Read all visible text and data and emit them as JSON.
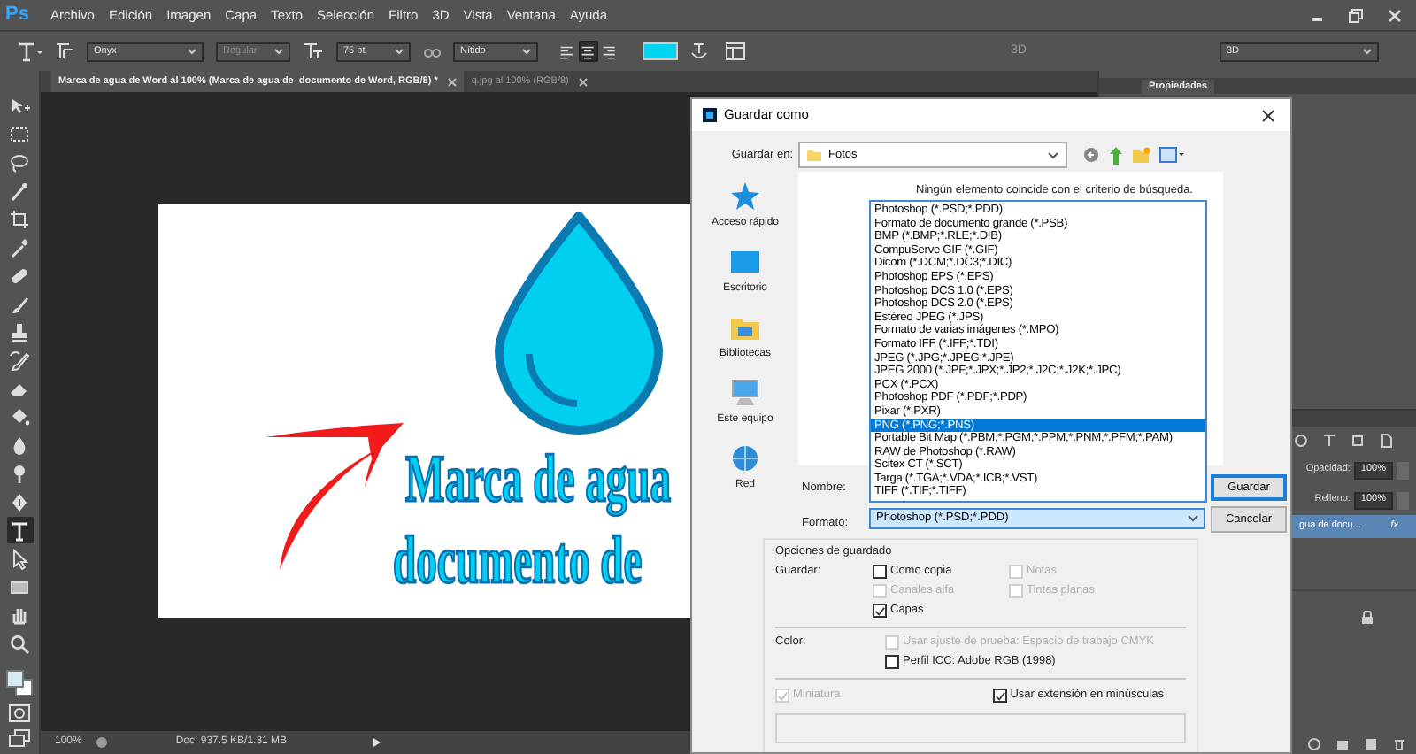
{
  "app": {
    "logo": "Ps",
    "menu": [
      "Archivo",
      "Edición",
      "Imagen",
      "Capa",
      "Texto",
      "Selección",
      "Filtro",
      "3D",
      "Vista",
      "Ventana",
      "Ayuda"
    ]
  },
  "options_bar": {
    "font": "Onyx",
    "style": "Regular",
    "style_disabled": true,
    "size": "75 pt",
    "antialias": "Nítido",
    "alignment": [
      {
        "selected": false
      },
      {
        "selected": true
      },
      {
        "selected": false
      }
    ],
    "swatch": {
      "color": "#00d4f0"
    },
    "mode_label": "3D",
    "workspace": "3D"
  },
  "tabs": [
    {
      "label": "Marca de agua de Word al 100% (Marca de agua de  documento de Word, RGB/8) *",
      "selected": true
    },
    {
      "label": "q.jpg al 100% (RGB/8)",
      "selected": false
    }
  ],
  "tools": [
    {
      "kind": "move",
      "selected": false
    },
    {
      "kind": "marquee",
      "selected": false
    },
    {
      "kind": "lasso",
      "selected": false
    },
    {
      "kind": "wand",
      "selected": false
    },
    {
      "kind": "crop",
      "selected": false
    },
    {
      "kind": "eyedropper",
      "selected": false
    },
    {
      "kind": "bandage",
      "selected": false
    },
    {
      "kind": "brush",
      "selected": false
    },
    {
      "kind": "stamp",
      "selected": false
    },
    {
      "kind": "history",
      "selected": false
    },
    {
      "kind": "eraser",
      "selected": false
    },
    {
      "kind": "bucket",
      "selected": false
    },
    {
      "kind": "drop",
      "selected": false
    },
    {
      "kind": "dodge",
      "selected": false
    },
    {
      "kind": "pen",
      "selected": false
    },
    {
      "kind": "type",
      "selected": true
    },
    {
      "kind": "select",
      "selected": false
    },
    {
      "kind": "rectangle",
      "selected": false
    },
    {
      "kind": "hand",
      "selected": false
    },
    {
      "kind": "zoom",
      "selected": false
    }
  ],
  "document": {
    "lines": [
      "Marca de agua",
      "documento de"
    ]
  },
  "status_bar": {
    "zoom": "100%",
    "doc": "Doc: 937.5 KB/1.31 MB"
  },
  "properties_panel": {
    "tab": "Propiedades"
  },
  "layers_panel": {
    "opacity_label": "Opacidad:",
    "opacity": "100%",
    "fill_label": "Relleno:",
    "fill": "100%",
    "layers": [
      {
        "name": "gua de docu...",
        "selected": true,
        "effects": "fx"
      }
    ]
  },
  "dialog": {
    "title": "Guardar como",
    "save_in_label": "Guardar en:",
    "folder": "Fotos",
    "places": [
      {
        "kind": "star",
        "label": "Acceso rápido"
      },
      {
        "kind": "desktop",
        "label": "Escritorio"
      },
      {
        "kind": "library",
        "label": "Bibliotecas"
      },
      {
        "kind": "computer",
        "label": "Este equipo"
      },
      {
        "kind": "network",
        "label": "Red"
      }
    ],
    "empty_message": "Ningún elemento coincide con el criterio de búsqueda.",
    "name_label": "Nombre:",
    "format_label": "Formato:",
    "format_value": "Photoshop (*.PSD;*.PDD)",
    "format_options": [
      {
        "label": "Photoshop (*.PSD;*.PDD)",
        "selected": false
      },
      {
        "label": "Formato de documento grande (*.PSB)",
        "selected": false
      },
      {
        "label": "BMP (*.BMP;*.RLE;*.DIB)",
        "selected": false
      },
      {
        "label": "CompuServe GIF (*.GIF)",
        "selected": false
      },
      {
        "label": "Dicom (*.DCM;*.DC3;*.DIC)",
        "selected": false
      },
      {
        "label": "Photoshop EPS (*.EPS)",
        "selected": false
      },
      {
        "label": "Photoshop DCS 1.0 (*.EPS)",
        "selected": false
      },
      {
        "label": "Photoshop DCS 2.0 (*.EPS)",
        "selected": false
      },
      {
        "label": "Estéreo JPEG (*.JPS)",
        "selected": false
      },
      {
        "label": "Formato de varias imágenes (*.MPO)",
        "selected": false
      },
      {
        "label": "Formato IFF (*.IFF;*.TDI)",
        "selected": false
      },
      {
        "label": "JPEG (*.JPG;*.JPEG;*.JPE)",
        "selected": false
      },
      {
        "label": "JPEG 2000 (*.JPF;*.JPX;*.JP2;*.J2C;*.J2K;*.JPC)",
        "selected": false
      },
      {
        "label": "PCX (*.PCX)",
        "selected": false
      },
      {
        "label": "Photoshop PDF (*.PDF;*.PDP)",
        "selected": false
      },
      {
        "label": "Pixar (*.PXR)",
        "selected": false
      },
      {
        "label": "PNG (*.PNG;*.PNS)",
        "selected": true
      },
      {
        "label": "Portable Bit Map (*.PBM;*.PGM;*.PPM;*.PNM;*.PFM;*.PAM)",
        "selected": false
      },
      {
        "label": "RAW de Photoshop (*.RAW)",
        "selected": false
      },
      {
        "label": "Scitex CT (*.SCT)",
        "selected": false
      },
      {
        "label": "Targa (*.TGA;*.VDA;*.ICB;*.VST)",
        "selected": false
      },
      {
        "label": "TIFF (*.TIF;*.TIFF)",
        "selected": false
      }
    ],
    "buttons": [
      {
        "label": "Guardar",
        "default": true
      },
      {
        "label": "Cancelar",
        "default": false
      }
    ],
    "options": {
      "title": "Opciones de guardado",
      "save_label": "Guardar:",
      "save_checks": [
        {
          "label": "Como copia",
          "checked": false,
          "disabled": false
        },
        {
          "label": "Notas",
          "checked": false,
          "disabled": true
        },
        {
          "label": "Canales alfa",
          "checked": false,
          "disabled": true
        },
        {
          "label": "Tintas planas",
          "checked": false,
          "disabled": true
        },
        {
          "label": "Capas",
          "checked": true,
          "disabled": false
        }
      ],
      "color_label": "Color:",
      "color_checks": [
        {
          "label": "Usar ajuste de prueba: Espacio de trabajo CMYK",
          "checked": false,
          "disabled": true
        },
        {
          "label": "Perfil ICC: Adobe RGB (1998)",
          "checked": false,
          "disabled": false
        }
      ],
      "bottom_checks": [
        {
          "label": "Miniatura",
          "checked": true,
          "disabled": true
        },
        {
          "label": "Usar extensión en minúsculas",
          "checked": true,
          "disabled": false
        }
      ]
    }
  }
}
